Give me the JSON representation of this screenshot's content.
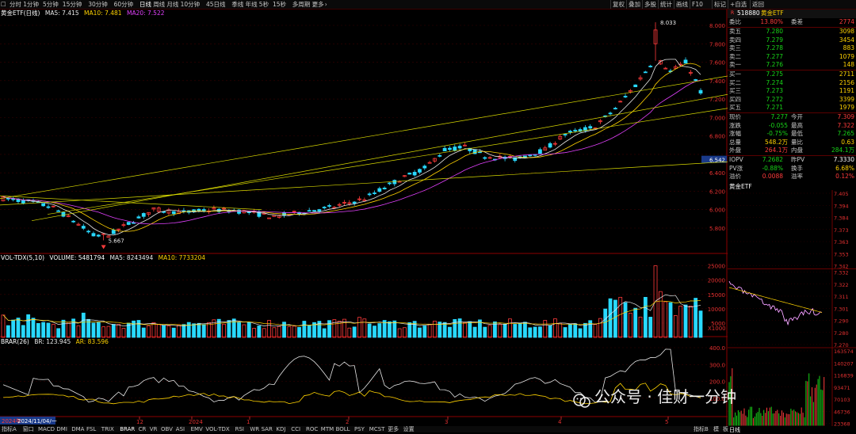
{
  "toolbar": {
    "periods": [
      "分时",
      "1分钟",
      "5分钟",
      "15分钟",
      "30分钟",
      "60分钟",
      "日线",
      "周线",
      "月线",
      "10分钟",
      "45日线",
      "季线",
      "年线",
      "5秒",
      "15秒",
      "多周期",
      "更多"
    ],
    "active_period": "日线",
    "right_buttons": [
      "复权",
      "叠加",
      "多股",
      "统计",
      "画线",
      "F10",
      "标记",
      "+自选",
      "返回"
    ]
  },
  "main_header": {
    "name": "黄金ETF(日线)",
    "ma5": "MA5: 7.415",
    "ma10": "MA10: 7.481",
    "ma20": "MA20: 7.522"
  },
  "price_axis": [
    "8.000",
    "7.800",
    "7.600",
    "7.400",
    "7.200",
    "7.000",
    "6.800",
    "6.542",
    "6.400",
    "6.200",
    "6.000",
    "5.800"
  ],
  "price_marks": {
    "high": "8.033",
    "low": "5.667"
  },
  "volume_header": {
    "name": "VOL-TDX(5,10)",
    "volume": "VOLUME: 5481794",
    "ma5": "MA5: 8243494",
    "ma10": "MA10: 7733204"
  },
  "volume_axis": [
    "25000",
    "20000",
    "15000",
    "10000",
    "5000"
  ],
  "volume_unit": "X1000",
  "brar_header": {
    "name": "BRAR(26)",
    "br": "BR: 123.945",
    "ar": "AR: 83.596"
  },
  "brar_axis": [
    "400.0",
    "300.0",
    "200.0",
    "100.0"
  ],
  "date_axis": {
    "start": "2024年",
    "cursor": "2024/11/04/一",
    "ticks": [
      "12",
      "2024",
      "1",
      "2",
      "3",
      "4",
      "5"
    ]
  },
  "bottom_tabs": [
    "指标A",
    "窗口",
    "MACD",
    "DMI",
    "DMA",
    "FSL",
    "TRIX",
    "BRAR",
    "CR",
    "VR",
    "OBV",
    "ASI",
    "EMV",
    "VOL-TDX",
    "RSI",
    "WR",
    "SAR",
    "KDJ",
    "CCI",
    "ROC",
    "MTM",
    "BOLL",
    "PSY",
    "MCST",
    "更多",
    "设置"
  ],
  "bottom_right": [
    "指标B",
    "模",
    "板"
  ],
  "quote": {
    "code": "518880",
    "name": "黄金ETF",
    "wei_bi_label": "委比",
    "wei_bi": "13.80%",
    "wei_cha_label": "委差",
    "wei_cha": "2774",
    "asks": [
      {
        "label": "卖五",
        "price": "7.280",
        "vol": "3098"
      },
      {
        "label": "卖四",
        "price": "7.279",
        "vol": "3454"
      },
      {
        "label": "卖三",
        "price": "7.278",
        "vol": "883"
      },
      {
        "label": "卖二",
        "price": "7.277",
        "vol": "1079"
      },
      {
        "label": "卖一",
        "price": "7.276",
        "vol": "148"
      }
    ],
    "bids": [
      {
        "label": "买一",
        "price": "7.275",
        "vol": "2711"
      },
      {
        "label": "买二",
        "price": "7.274",
        "vol": "2156"
      },
      {
        "label": "买三",
        "price": "7.273",
        "vol": "1191"
      },
      {
        "label": "买四",
        "price": "7.272",
        "vol": "3399"
      },
      {
        "label": "买五",
        "price": "7.271",
        "vol": "1979"
      }
    ],
    "stats": [
      {
        "l1": "现价",
        "v1": "7.277",
        "l2": "今开",
        "v2": "7.309"
      },
      {
        "l1": "涨跌",
        "v1": "-0.055",
        "l2": "最高",
        "v2": "7.322"
      },
      {
        "l1": "涨幅",
        "v1": "-0.75%",
        "l2": "最低",
        "v2": "7.265"
      },
      {
        "l1": "总量",
        "v1": "548.2万",
        "l2": "量比",
        "v2": "0.63"
      },
      {
        "l1": "外盘",
        "v1": "264.1万",
        "l2": "内盘",
        "v2": "284.1万"
      }
    ],
    "iopv": [
      {
        "l1": "IOPV",
        "v1": "7.2682",
        "l2": "昨PV",
        "v2": "7.3330"
      },
      {
        "l1": "PV涨",
        "v1": "-0.88%",
        "l2": "换手",
        "v2": "6.68%"
      },
      {
        "l1": "溢价",
        "v1": "0.0088",
        "l2": "溢率",
        "v2": "0.12%"
      }
    ]
  },
  "intraday": {
    "title": "黄金ETF",
    "price_axis": [
      "7.405",
      "7.394",
      "7.384",
      "7.373",
      "7.363",
      "7.353",
      "7.342"
    ],
    "lower_axis": [
      "7.332",
      "7.322",
      "7.311",
      "7.301",
      "7.290",
      "7.280",
      "7.270"
    ],
    "vol_axis": [
      "163574",
      "140207",
      "116839",
      "93471",
      "70103",
      "46736",
      "23368"
    ],
    "footer": "日线"
  },
  "watermark": "公众号 · 佳财一分钟",
  "colors": {
    "up": "#ff3b3b",
    "down": "#29d9ff",
    "ma5": "#e8e8e8",
    "ma10": "#ffd200",
    "ma20": "#e040fb",
    "channel": "#d8d800",
    "axis": "#8b0000"
  }
}
